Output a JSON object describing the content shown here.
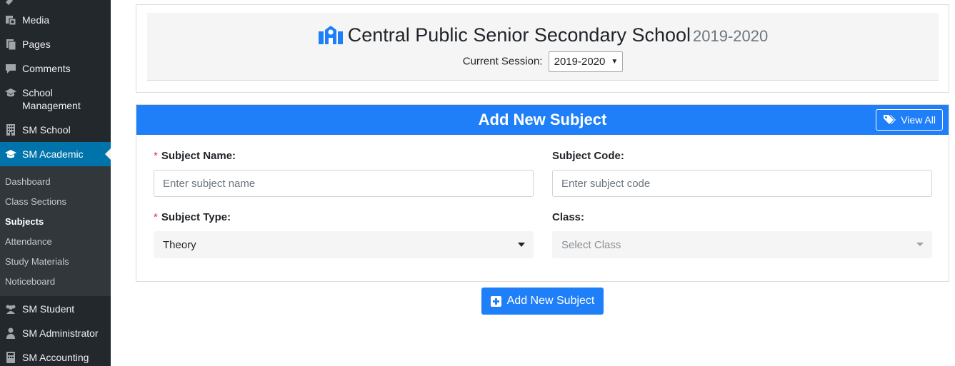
{
  "sidebar": {
    "menu": [
      {
        "label": "Media",
        "icon": "media-icon"
      },
      {
        "label": "Pages",
        "icon": "pages-icon"
      },
      {
        "label": "Comments",
        "icon": "comments-icon"
      },
      {
        "label": "School Management",
        "icon": "graduation-cap-icon"
      },
      {
        "label": "SM School",
        "icon": "building-icon"
      },
      {
        "label": "SM Academic",
        "icon": "graduation-cap-icon",
        "active": true
      },
      {
        "label": "SM Student",
        "icon": "users-icon"
      },
      {
        "label": "SM Administrator",
        "icon": "user-icon"
      },
      {
        "label": "SM Accounting",
        "icon": "calculator-icon"
      }
    ],
    "submenu": [
      {
        "label": "Dashboard"
      },
      {
        "label": "Class Sections"
      },
      {
        "label": "Subjects",
        "current": true
      },
      {
        "label": "Attendance"
      },
      {
        "label": "Study Materials"
      },
      {
        "label": "Noticeboard"
      }
    ]
  },
  "header": {
    "school_name": "Central Public Senior Secondary School",
    "year": "2019-2020",
    "session_label": "Current Session:",
    "session_value": "2019-2020",
    "icon": "school-icon"
  },
  "form": {
    "title": "Add New Subject",
    "view_all_label": "View All",
    "subject_name_label": "Subject Name:",
    "subject_name_placeholder": "Enter subject name",
    "subject_code_label": "Subject Code:",
    "subject_code_placeholder": "Enter subject code",
    "subject_type_label": "Subject Type:",
    "subject_type_value": "Theory",
    "class_label": "Class:",
    "class_placeholder": "Select Class",
    "required_mark": "*",
    "submit_label": "Add New Subject"
  },
  "colors": {
    "sidebar_bg": "#23282d",
    "submenu_bg": "#32373c",
    "active_bg": "#0073aa",
    "primary": "#1f7ff8",
    "required": "#dc3545"
  }
}
